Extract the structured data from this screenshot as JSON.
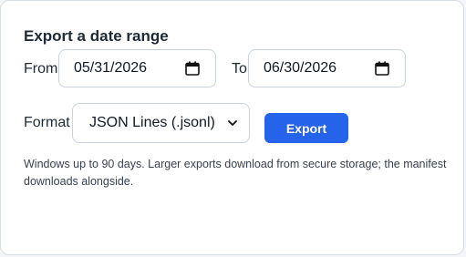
{
  "title": "Export a date range",
  "from": {
    "label": "From",
    "value": "05/31/2026"
  },
  "to": {
    "label": "To",
    "value": "06/30/2026"
  },
  "format": {
    "label": "Format",
    "selected": "JSON Lines (.jsonl)"
  },
  "export_button": "Export",
  "note": "Windows up to 90 days. Larger exports download from secure storage; the manifest downloads alongside.",
  "colors": {
    "accent": "#2563eb",
    "border": "#c9d2de"
  },
  "icons": {
    "date_picker": "calendar-icon",
    "select": "chevron-down-icon"
  }
}
